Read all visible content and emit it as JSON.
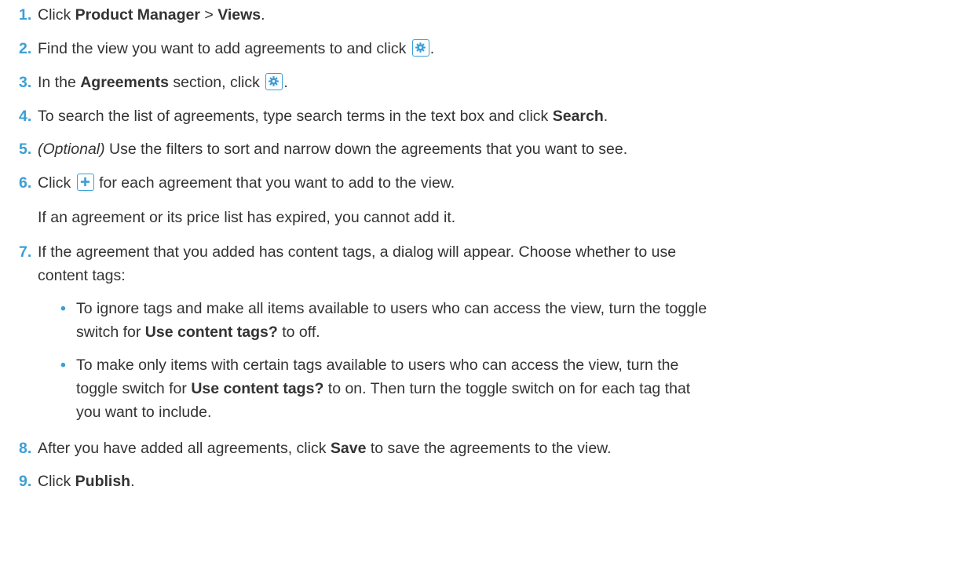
{
  "steps": [
    {
      "number": "1.",
      "parts": {
        "a": "Click ",
        "b1": "Product Manager",
        "c": " > ",
        "b2": "Views",
        "d": "."
      }
    },
    {
      "number": "2.",
      "parts": {
        "a": "Find the view you want to add agreements to and click ",
        "d": "."
      },
      "icon": "gear-icon"
    },
    {
      "number": "3.",
      "parts": {
        "a": "In the ",
        "b1": "Agreements",
        "c": " section, click ",
        "d": "."
      },
      "icon": "gear-icon"
    },
    {
      "number": "4.",
      "parts": {
        "a": "To search the list of agreements, type search terms in the text box and click ",
        "b1": "Search",
        "d": "."
      }
    },
    {
      "number": "5.",
      "parts": {
        "i1": "(Optional)",
        "a": " Use the filters to sort and narrow down the agreements that you want to see."
      }
    },
    {
      "number": "6.",
      "parts": {
        "a": "Click ",
        "c": " for each agreement that you want to add to the view."
      },
      "icon": "plus-icon",
      "note": "If an agreement or its price list has expired, you cannot add it."
    },
    {
      "number": "7.",
      "lines": [
        "If the agreement that you added has content tags, a dialog will appear. Choose whether to use",
        "content tags:"
      ],
      "bullets": [
        {
          "marker": "•",
          "line1": "To ignore tags and make all items available to users who can access the view, turn the toggle",
          "line2_a": "switch for ",
          "line2_b": "Use content tags?",
          "line2_c": " to off."
        },
        {
          "marker": "•",
          "line1": "To make only items with certain tags available to users who can access the view, turn the",
          "line2_a": "toggle switch for ",
          "line2_b": "Use content tags?",
          "line2_c": " to on. Then turn the toggle switch on for each tag that",
          "line3": "you want to include."
        }
      ]
    },
    {
      "number": "8.",
      "parts": {
        "a": "After you have added all agreements, click ",
        "b1": "Save",
        "c": " to save the agreements to the view."
      }
    },
    {
      "number": "9.",
      "parts": {
        "a": "Click ",
        "b1": "Publish",
        "d": "."
      }
    }
  ],
  "colors": {
    "accent": "#3b9fd6",
    "text": "#333333"
  }
}
